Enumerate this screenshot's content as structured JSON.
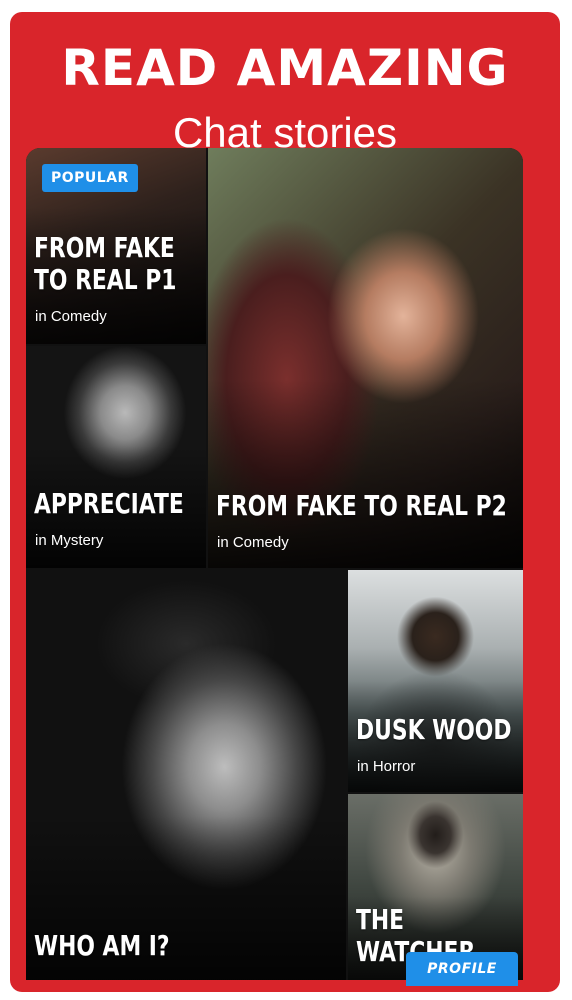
{
  "header": {
    "line1": "READ AMAZING",
    "line2": "Chat stories"
  },
  "badge": "POPULAR",
  "stories": [
    {
      "title_l1": "FROM FAKE",
      "title_l2": "TO REAL P1",
      "category": "in Comedy"
    },
    {
      "title_l1": "FROM FAKE TO REAL P2",
      "category": "in Comedy"
    },
    {
      "title_l1": "APPRECIATE",
      "category": "in Mystery"
    },
    {
      "title_l1": "WHO AM I?",
      "category": ""
    },
    {
      "title_l1": "DUSK WOOD",
      "category": "in Horror"
    },
    {
      "title_l1": "THE",
      "title_l2": "WATCHER",
      "category": ""
    }
  ],
  "profile_tab": "PROFILE",
  "colors": {
    "brand_red": "#d9252b",
    "accent_blue": "#1f8fe8"
  }
}
